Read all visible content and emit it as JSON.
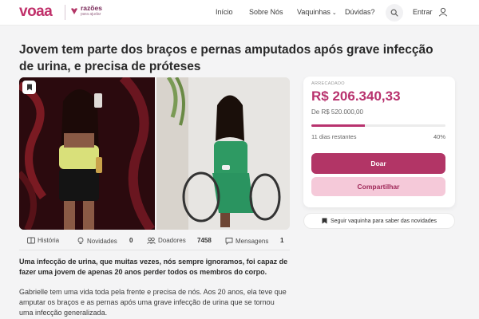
{
  "header": {
    "logo": "voaa",
    "partner_logo_top": "razões",
    "partner_logo_bottom": "para ajudar",
    "nav": [
      {
        "label": "Início"
      },
      {
        "label": "Sobre Nós"
      },
      {
        "label": "Vaquinhas"
      },
      {
        "label": "Dúvidas?"
      }
    ],
    "dropdown_caret": "⌄",
    "login_label": "Entrar"
  },
  "campaign": {
    "title": "Jovem tem parte dos braços e pernas amputados após grave infecção de urina, e precisa de próteses",
    "tabs": [
      {
        "label": "História",
        "icon": "book-icon"
      },
      {
        "label": "Novidades",
        "count": "0",
        "icon": "bulb-icon"
      },
      {
        "label": "Doadores",
        "count": "7458",
        "icon": "people-icon"
      },
      {
        "label": "Mensagens",
        "count": "1",
        "icon": "chat-icon"
      }
    ],
    "lead": "Uma infecção de urina, que muitas vezes, nós sempre ignoramos, foi capaz de fazer uma jovem de apenas 20 anos perder todos os membros do corpo.",
    "body": "Gabrielle tem uma vida toda pela frente e precisa de nós. Aos 20 anos, ela teve que amputar os braços e as pernas após uma grave infecção de urina que se tornou uma infecção generalizada."
  },
  "donation": {
    "raised_label": "ARRECADADO",
    "raised_value": "R$ 206.340,33",
    "goal_text": "De R$ 520.000,00",
    "progress_fraction": 0.4,
    "days_left": "11 dias restantes",
    "percent": "40%",
    "donate_label": "Doar",
    "share_label": "Compartilhar",
    "follow_label": "Seguir vaquinha para saber das novidades"
  },
  "colors": {
    "brand": "#c0306a",
    "primary_button": "#b23566",
    "secondary_button": "#f5c9d9"
  }
}
